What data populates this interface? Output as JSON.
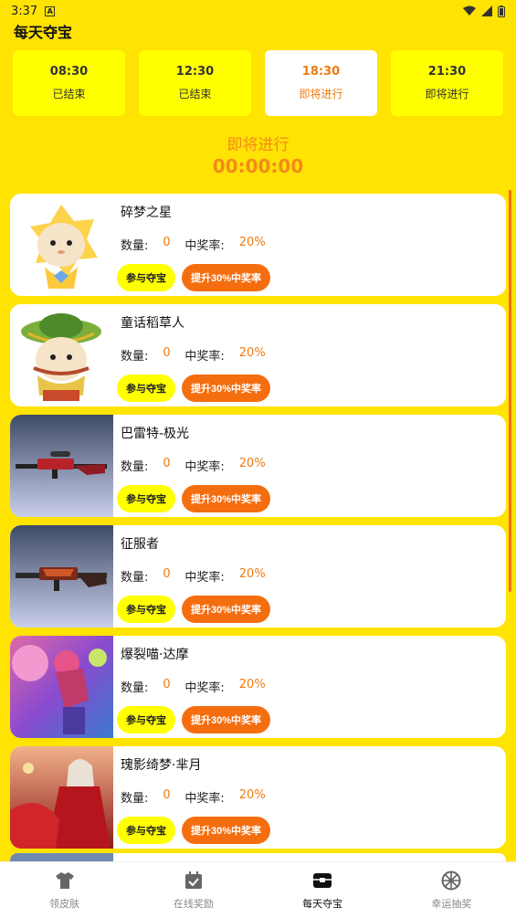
{
  "status_bar": {
    "time": "3:37"
  },
  "header": {
    "title": "每天夺宝"
  },
  "slots": [
    {
      "time": "08:30",
      "status": "已结束"
    },
    {
      "time": "12:30",
      "status": "已结束"
    },
    {
      "time": "18:30",
      "status": "即将进行"
    },
    {
      "time": "21:30",
      "status": "即将进行"
    }
  ],
  "countdown": {
    "label": "即将进行",
    "timer": "00:00:00"
  },
  "labels": {
    "quantity": "数量:",
    "win_rate": "中奖率:",
    "join": "参与夺宝",
    "boost": "提升30%中奖率"
  },
  "items": [
    {
      "name": "碎梦之星",
      "quantity": "0",
      "rate": "20%"
    },
    {
      "name": "童话稻草人",
      "quantity": "0",
      "rate": "20%"
    },
    {
      "name": "巴雷特-极光",
      "quantity": "0",
      "rate": "20%"
    },
    {
      "name": "征服者",
      "quantity": "0",
      "rate": "20%"
    },
    {
      "name": "爆裂喵·达摩",
      "quantity": "0",
      "rate": "20%"
    },
    {
      "name": "瑰影绮梦·芈月",
      "quantity": "0",
      "rate": "20%"
    }
  ],
  "tabs": [
    {
      "label": "领皮肤",
      "icon": "shirt-icon"
    },
    {
      "label": "在线奖励",
      "icon": "calendar-check-icon"
    },
    {
      "label": "每天夺宝",
      "icon": "treasure-box-icon"
    },
    {
      "label": "幸运抽奖",
      "icon": "wheel-icon"
    }
  ],
  "colors": {
    "background": "#FFE303",
    "accent": "#F46E10",
    "slot": "#FFFF00"
  }
}
